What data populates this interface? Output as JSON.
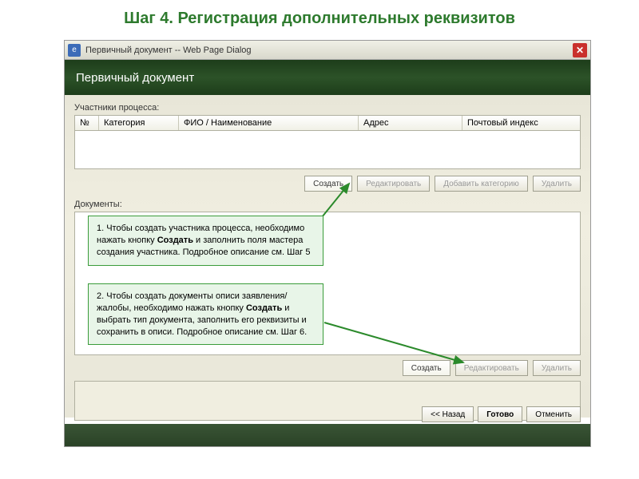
{
  "slide": {
    "title": "Шаг 4. Регистрация дополнительных реквизитов"
  },
  "titlebar": {
    "text": "Первичный документ -- Web Page Dialog"
  },
  "banner": {
    "text": "Первичный документ"
  },
  "participants": {
    "label": "Участники процесса:",
    "columns": {
      "no": "№",
      "category": "Категория",
      "fio": "ФИО / Наименование",
      "address": "Адрес",
      "index": "Почтовый индекс"
    },
    "buttons": {
      "create": "Создать",
      "edit": "Редактировать",
      "addcat": "Добавить категорию",
      "delete": "Удалить"
    }
  },
  "documents": {
    "label": "Документы:",
    "buttons": {
      "create": "Создать",
      "edit": "Редактировать",
      "delete": "Удалить"
    }
  },
  "footer": {
    "back": "<< Назад",
    "ready": "Готово",
    "cancel": "Отменить"
  },
  "callouts": {
    "c1": {
      "prefix": "1. Чтобы создать участника процесса, необходимо нажать кнопку ",
      "bold": "Создать",
      "suffix": " и заполнить поля мастера создания участника. Подробное описание см. Шаг 5"
    },
    "c2": {
      "prefix": "2. Чтобы создать документы описи заявления/жалобы, необходимо нажать кнопку ",
      "bold": "Создать",
      "suffix": " и  выбрать тип документа, заполнить его реквизиты и сохранить в описи. Подробное описание см. Шаг 6."
    }
  }
}
